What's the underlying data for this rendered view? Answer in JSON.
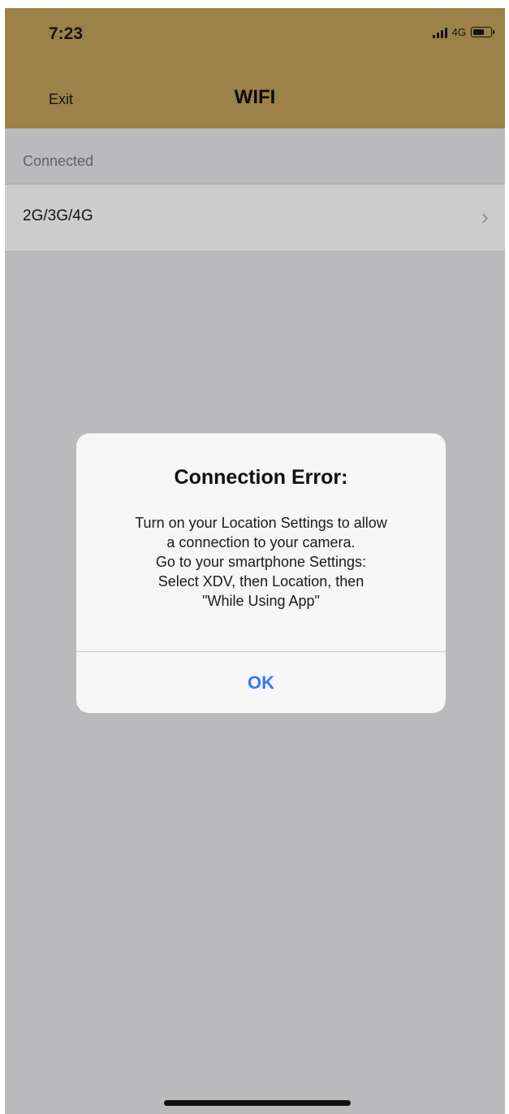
{
  "status_bar": {
    "time": "7:23",
    "network": "4G",
    "battery_level": 0.65
  },
  "nav": {
    "exit_label": "Exit",
    "title": "WIFI"
  },
  "list": {
    "section_header": "Connected",
    "items": [
      {
        "label": "2G/3G/4G"
      }
    ]
  },
  "alert": {
    "title": "Connection Error:",
    "message_lines": [
      "Turn on your Location Settings to allow",
      "a connection to your camera.",
      "Go to your smartphone Settings:",
      "Select XDV, then Location, then",
      "\"While Using App\""
    ],
    "ok_label": "OK"
  },
  "colors": {
    "header": "#c4a25a",
    "accent": "#3478f6"
  }
}
